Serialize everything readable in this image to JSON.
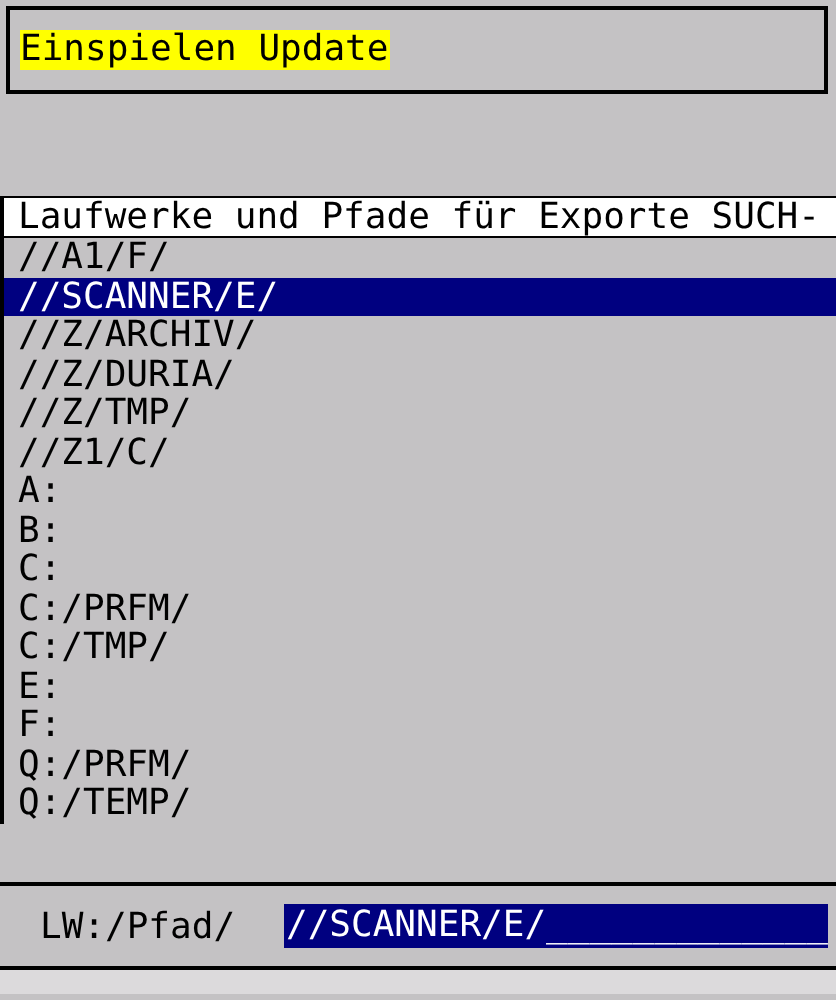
{
  "title": "Einspielen Update",
  "list": {
    "header": "Laufwerke und Pfade für Exporte SUCH-",
    "items": [
      {
        "label": "//A1/F/",
        "selected": false
      },
      {
        "label": "//SCANNER/E/",
        "selected": true
      },
      {
        "label": "//Z/ARCHIV/",
        "selected": false
      },
      {
        "label": "//Z/DURIA/",
        "selected": false
      },
      {
        "label": "//Z/TMP/",
        "selected": false
      },
      {
        "label": "//Z1/C/",
        "selected": false
      },
      {
        "label": "A:",
        "selected": false
      },
      {
        "label": "B:",
        "selected": false
      },
      {
        "label": "C:",
        "selected": false
      },
      {
        "label": "C:/PRFM/",
        "selected": false
      },
      {
        "label": "C:/TMP/",
        "selected": false
      },
      {
        "label": "E:",
        "selected": false
      },
      {
        "label": "F:",
        "selected": false
      },
      {
        "label": "Q:/PRFM/",
        "selected": false
      },
      {
        "label": "Q:/TEMP/",
        "selected": false
      }
    ]
  },
  "field": {
    "label": "LW:/Pfad/",
    "value": "//SCANNER/E/_____________"
  }
}
